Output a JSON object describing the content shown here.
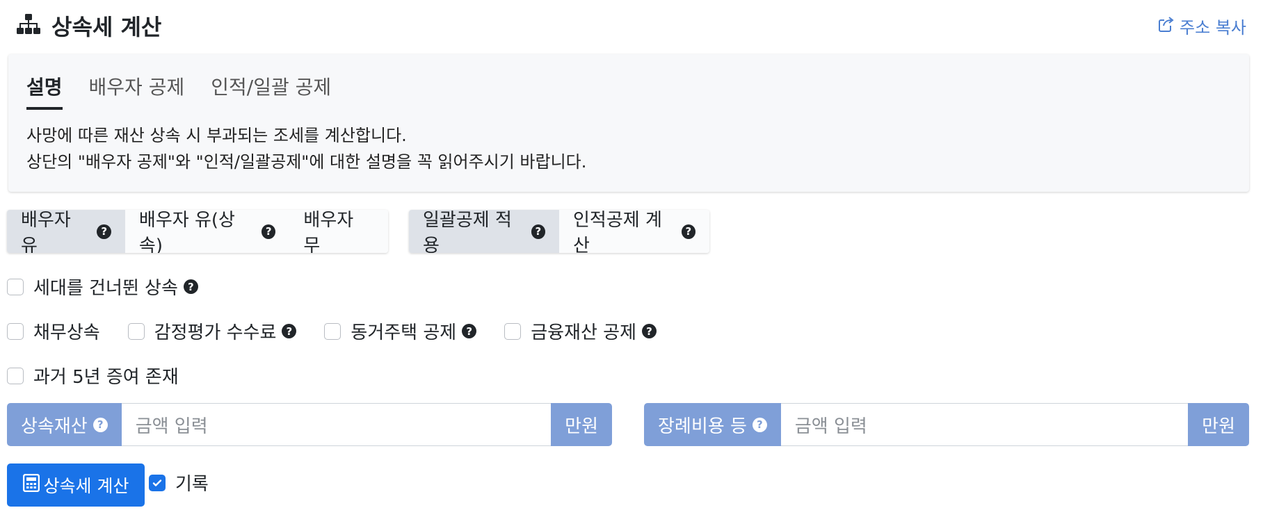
{
  "header": {
    "title": "상속세 계산",
    "copy_link": "주소 복사"
  },
  "tabs": [
    "설명",
    "배우자 공제",
    "인적/일괄 공제"
  ],
  "description": {
    "line1": "사망에 따른 재산 상속 시 부과되는 조세를 계산합니다.",
    "line2": "상단의 \"배우자 공제\"와 \"인적/일괄공제\"에 대한 설명을 꼭 읽어주시기 바랍니다."
  },
  "spouse_options": {
    "opt1": "배우자 유",
    "opt2": "배우자 유(상속)",
    "opt3": "배우자 무",
    "selected": "배우자 유"
  },
  "deduction_options": {
    "opt1": "일괄공제 적용",
    "opt2": "인적공제 계산",
    "selected": "일괄공제 적용"
  },
  "checkboxes": {
    "generation_skip": "세대를 건너뛴 상속",
    "debt": "채무상속",
    "appraisal_fee": "감정평가 수수료",
    "cohabiting_house": "동거주택 공제",
    "financial_asset": "금융재산 공제",
    "past_gift": "과거 5년 증여 존재"
  },
  "inputs": {
    "inheritance": {
      "label": "상속재산",
      "placeholder": "금액 입력",
      "unit": "만원"
    },
    "funeral": {
      "label": "장례비용 등",
      "placeholder": "금액 입력",
      "unit": "만원"
    }
  },
  "actions": {
    "calculate": "상속세 계산",
    "record": "기록"
  },
  "colors": {
    "accent": "#1a73e8",
    "input_label": "#7f9fd8",
    "link": "#4a7ed1"
  },
  "icons": [
    "sitemap-icon",
    "share-icon",
    "question-circle-icon",
    "calculator-icon",
    "check-icon"
  ]
}
